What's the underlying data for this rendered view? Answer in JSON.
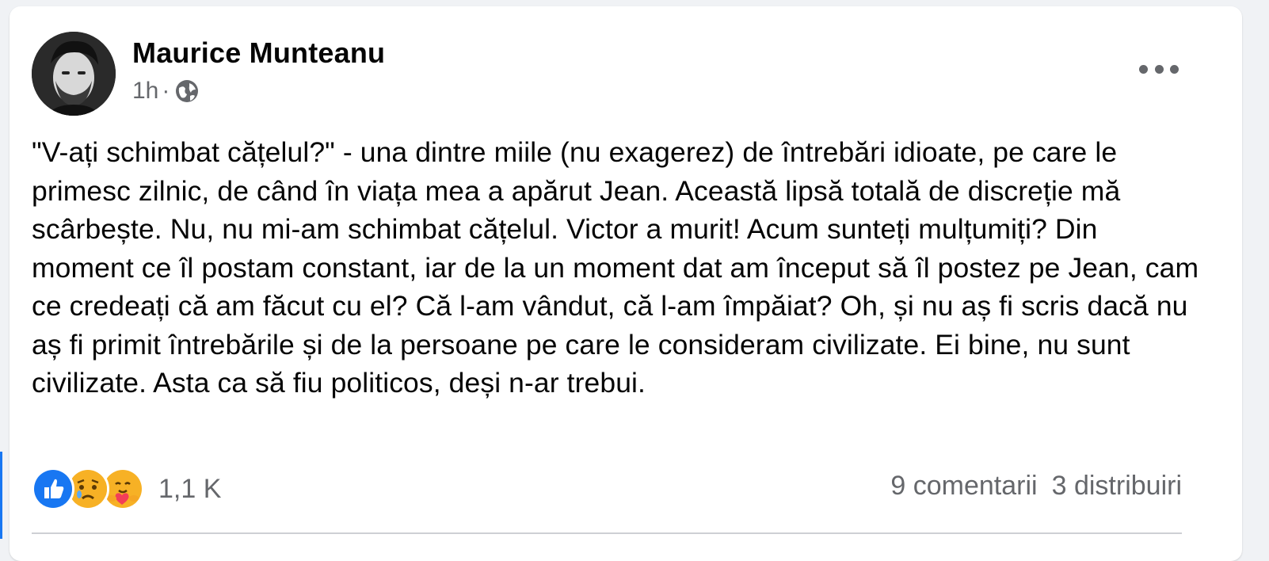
{
  "post": {
    "author": "Maurice Munteanu",
    "time": "1h",
    "separator": "·",
    "privacy_icon": "globe-icon",
    "more_icon": "more-options-icon",
    "text": "\"V-ați schimbat cățelul?\" - una dintre miile (nu exagerez) de întrebări idioate, pe care le primesc zilnic, de când în viața mea a apărut Jean. Această lipsă totală de discreție mă scârbește. Nu, nu mi-am schimbat cățelul. Victor a murit! Acum sunteți mulțumiți? Din moment ce îl postam constant, iar de la un moment dat am început să îl postez pe Jean, cam ce credeați că am făcut cu el? Că l-am vândut, că l-am împăiat? Oh, și nu aș fi scris dacă nu aș fi primit întrebările și de la persoane pe care le consideram civilizate. Ei bine, nu sunt civilizate. Asta ca să fiu politicos, deși n-ar trebui."
  },
  "reactions": {
    "icons": [
      "like-icon",
      "sad-icon",
      "care-icon"
    ],
    "count": "1,1 K",
    "colors": {
      "like": "#1877f2",
      "emoji": "#f7b125"
    }
  },
  "stats": {
    "comments": "9 comentarii",
    "shares": "3 distribuiri"
  }
}
